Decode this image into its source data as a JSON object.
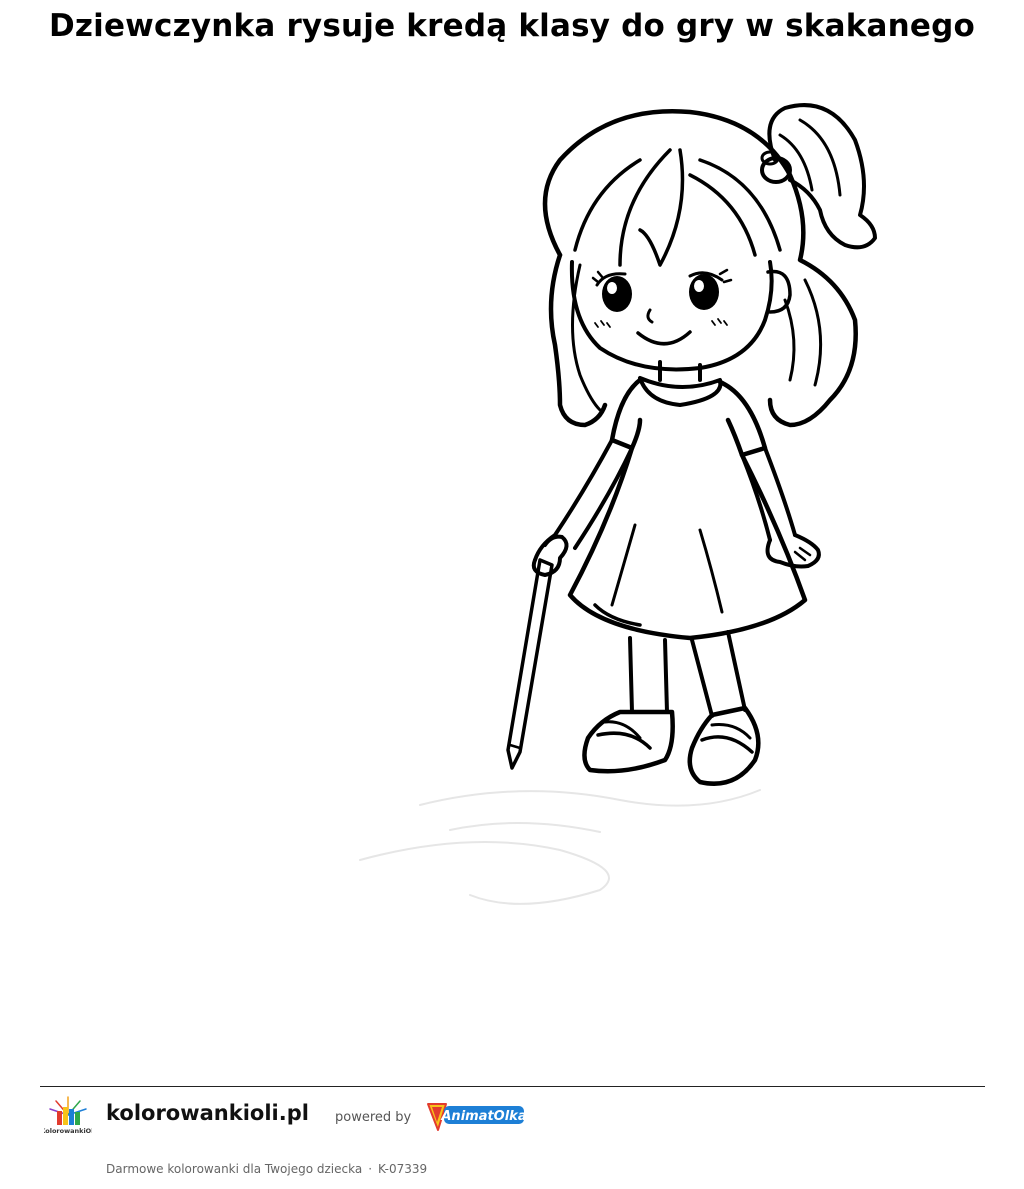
{
  "page": {
    "title": "Dziewczynka rysuje kredą klasy do gry w skakanego"
  },
  "artwork": {
    "subject": "girl-with-chalk-line-drawing"
  },
  "footer": {
    "logo_text": "KolorowankiOli",
    "site_name": "kolorowankioli.pl",
    "powered_by": "powered by",
    "partner_name": "AnimatOlka",
    "tagline": "Darmowe kolorowanki dla Twojego dziecka",
    "separator": "·",
    "code": "K-07339"
  },
  "colors": {
    "line": "#000000",
    "divider": "#222222",
    "partner_blue": "#1d7fd6",
    "partner_red": "#e23b2e",
    "partner_yellow": "#f7c31a"
  }
}
